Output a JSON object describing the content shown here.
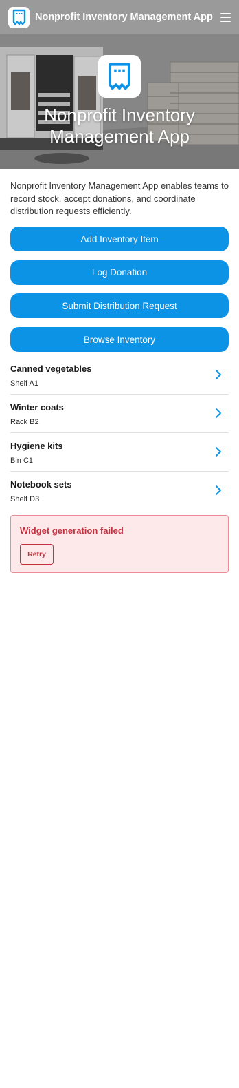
{
  "header": {
    "title": "Nonprofit Inventory Management App",
    "logo_icon": "receipt-icon",
    "menu_icon": "hamburger-menu-icon"
  },
  "hero": {
    "title": "Nonprofit Inventory Management App",
    "icon": "receipt-icon"
  },
  "description": "Nonprofit Inventory Management App enables teams to record stock, accept donations, and coordinate distribution requests efficiently.",
  "actions": [
    {
      "label": "Add Inventory Item"
    },
    {
      "label": "Log Donation"
    },
    {
      "label": "Submit Distribution Request"
    },
    {
      "label": "Browse Inventory"
    }
  ],
  "inventory": [
    {
      "name": "Canned vegetables",
      "location": "Shelf A1"
    },
    {
      "name": "Winter coats",
      "location": "Rack B2"
    },
    {
      "name": "Hygiene kits",
      "location": "Bin C1"
    },
    {
      "name": "Notebook sets",
      "location": "Shelf D3"
    }
  ],
  "error": {
    "title": "Widget generation failed",
    "retry_label": "Retry"
  },
  "colors": {
    "accent": "#0c93e6",
    "error_text": "#c0333f",
    "error_bg": "#fde8ea",
    "error_border": "#ee8c95"
  }
}
